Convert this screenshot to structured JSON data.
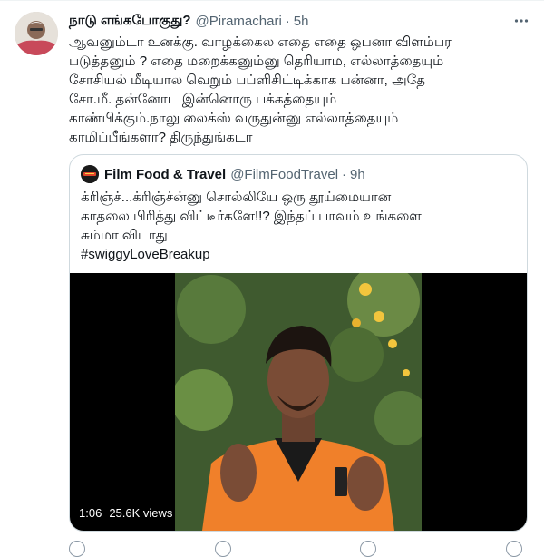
{
  "tweet": {
    "author": {
      "display_name": "நாடு எங்கபோகுது?",
      "handle": "@Piramachari",
      "separator": "·",
      "time": "5h",
      "avatar_icon": "avatar-photo-icon"
    },
    "more_icon": "more-horizontal-icon",
    "text": "ஆவனும்டா உனக்கு. வாழக்கைல எதை எதை ஒபனா விளம்பர\nபடுத்தனும் ? எதை மறைக்கனும்னு தெரியாம, எல்லாத்தையும்\nசோசியல் மீடியால வெறும் பப்ளிசிட்டிக்காக பன்னா, அதே\nசோ.மீ. தன்னோட இன்னொரு பக்கத்தையும்\nகாண்பிக்கும்.நாலு லைக்ஸ் வருதுன்னு எல்லாத்தையும்\nகாமிப்பீங்களா? திருந்துங்கடா"
  },
  "quoted_tweet": {
    "author": {
      "display_name": "Film Food & Travel",
      "handle": "@FilmFoodTravel",
      "separator": "·",
      "time": "9h"
    },
    "text": "க்ரிஞ்ச்...க்ரிஞ்ச்ன்னு  சொல்லியே ஒரு தூய்மையான\nகாதலை பிரித்து விட்டீர்களே!!? இந்தப் பாவம் உங்களை\nசும்மா விடாது",
    "hashtag": "#swiggyLoveBreakup",
    "media": {
      "duration": "1:06",
      "views": "25.6K views"
    }
  },
  "colors": {
    "text_primary": "#0f1419",
    "text_secondary": "#536471",
    "border": "#cfd9de",
    "media_background": "#000000",
    "shirt_orange": "#f0802a"
  }
}
